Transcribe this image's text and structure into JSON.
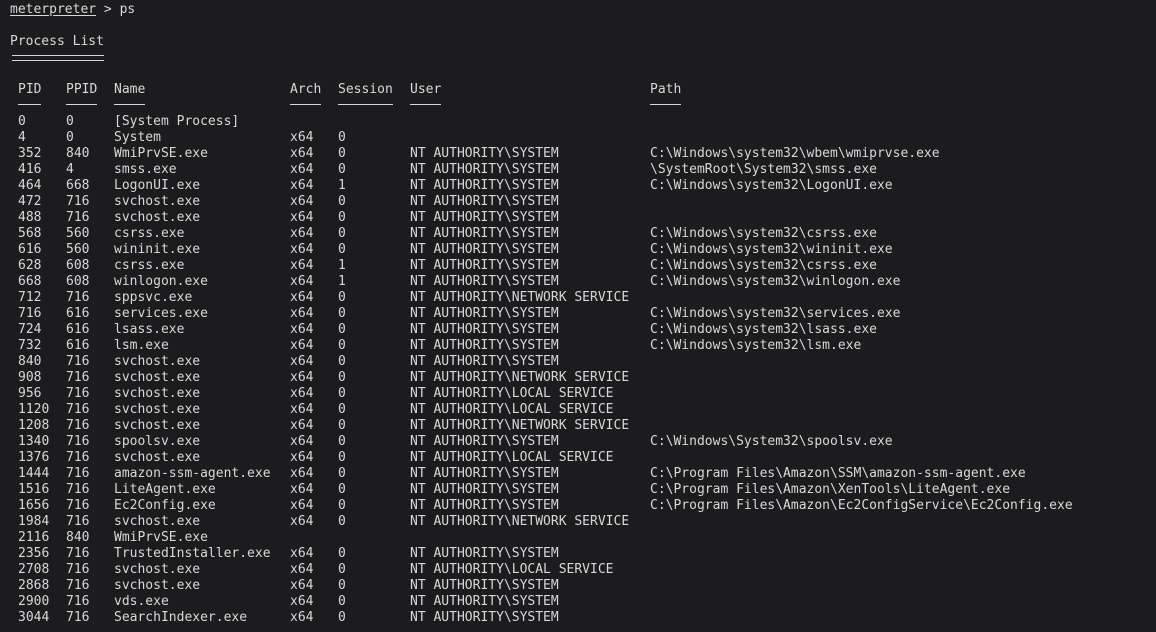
{
  "prompt": {
    "name": "meterpreter",
    "separator": " > ",
    "command": "ps"
  },
  "title": "Process List",
  "headers": {
    "pid": "PID",
    "ppid": "PPID",
    "name": "Name",
    "arch": "Arch",
    "session": "Session",
    "user": "User",
    "path": "Path"
  },
  "rows": [
    {
      "pid": "0",
      "ppid": "0",
      "name": "[System Process]",
      "arch": "",
      "session": "",
      "user": "",
      "path": ""
    },
    {
      "pid": "4",
      "ppid": "0",
      "name": "System",
      "arch": "x64",
      "session": "0",
      "user": "",
      "path": ""
    },
    {
      "pid": "352",
      "ppid": "840",
      "name": "WmiPrvSE.exe",
      "arch": "x64",
      "session": "0",
      "user": "NT AUTHORITY\\SYSTEM",
      "path": "C:\\Windows\\system32\\wbem\\wmiprvse.exe"
    },
    {
      "pid": "416",
      "ppid": "4",
      "name": "smss.exe",
      "arch": "x64",
      "session": "0",
      "user": "NT AUTHORITY\\SYSTEM",
      "path": "\\SystemRoot\\System32\\smss.exe"
    },
    {
      "pid": "464",
      "ppid": "668",
      "name": "LogonUI.exe",
      "arch": "x64",
      "session": "1",
      "user": "NT AUTHORITY\\SYSTEM",
      "path": "C:\\Windows\\system32\\LogonUI.exe"
    },
    {
      "pid": "472",
      "ppid": "716",
      "name": "svchost.exe",
      "arch": "x64",
      "session": "0",
      "user": "NT AUTHORITY\\SYSTEM",
      "path": ""
    },
    {
      "pid": "488",
      "ppid": "716",
      "name": "svchost.exe",
      "arch": "x64",
      "session": "0",
      "user": "NT AUTHORITY\\SYSTEM",
      "path": ""
    },
    {
      "pid": "568",
      "ppid": "560",
      "name": "csrss.exe",
      "arch": "x64",
      "session": "0",
      "user": "NT AUTHORITY\\SYSTEM",
      "path": "C:\\Windows\\system32\\csrss.exe"
    },
    {
      "pid": "616",
      "ppid": "560",
      "name": "wininit.exe",
      "arch": "x64",
      "session": "0",
      "user": "NT AUTHORITY\\SYSTEM",
      "path": "C:\\Windows\\system32\\wininit.exe"
    },
    {
      "pid": "628",
      "ppid": "608",
      "name": "csrss.exe",
      "arch": "x64",
      "session": "1",
      "user": "NT AUTHORITY\\SYSTEM",
      "path": "C:\\Windows\\system32\\csrss.exe"
    },
    {
      "pid": "668",
      "ppid": "608",
      "name": "winlogon.exe",
      "arch": "x64",
      "session": "1",
      "user": "NT AUTHORITY\\SYSTEM",
      "path": "C:\\Windows\\system32\\winlogon.exe"
    },
    {
      "pid": "712",
      "ppid": "716",
      "name": "sppsvc.exe",
      "arch": "x64",
      "session": "0",
      "user": "NT AUTHORITY\\NETWORK SERVICE",
      "path": ""
    },
    {
      "pid": "716",
      "ppid": "616",
      "name": "services.exe",
      "arch": "x64",
      "session": "0",
      "user": "NT AUTHORITY\\SYSTEM",
      "path": "C:\\Windows\\system32\\services.exe"
    },
    {
      "pid": "724",
      "ppid": "616",
      "name": "lsass.exe",
      "arch": "x64",
      "session": "0",
      "user": "NT AUTHORITY\\SYSTEM",
      "path": "C:\\Windows\\system32\\lsass.exe"
    },
    {
      "pid": "732",
      "ppid": "616",
      "name": "lsm.exe",
      "arch": "x64",
      "session": "0",
      "user": "NT AUTHORITY\\SYSTEM",
      "path": "C:\\Windows\\system32\\lsm.exe"
    },
    {
      "pid": "840",
      "ppid": "716",
      "name": "svchost.exe",
      "arch": "x64",
      "session": "0",
      "user": "NT AUTHORITY\\SYSTEM",
      "path": ""
    },
    {
      "pid": "908",
      "ppid": "716",
      "name": "svchost.exe",
      "arch": "x64",
      "session": "0",
      "user": "NT AUTHORITY\\NETWORK SERVICE",
      "path": ""
    },
    {
      "pid": "956",
      "ppid": "716",
      "name": "svchost.exe",
      "arch": "x64",
      "session": "0",
      "user": "NT AUTHORITY\\LOCAL SERVICE",
      "path": ""
    },
    {
      "pid": "1120",
      "ppid": "716",
      "name": "svchost.exe",
      "arch": "x64",
      "session": "0",
      "user": "NT AUTHORITY\\LOCAL SERVICE",
      "path": ""
    },
    {
      "pid": "1208",
      "ppid": "716",
      "name": "svchost.exe",
      "arch": "x64",
      "session": "0",
      "user": "NT AUTHORITY\\NETWORK SERVICE",
      "path": ""
    },
    {
      "pid": "1340",
      "ppid": "716",
      "name": "spoolsv.exe",
      "arch": "x64",
      "session": "0",
      "user": "NT AUTHORITY\\SYSTEM",
      "path": "C:\\Windows\\System32\\spoolsv.exe"
    },
    {
      "pid": "1376",
      "ppid": "716",
      "name": "svchost.exe",
      "arch": "x64",
      "session": "0",
      "user": "NT AUTHORITY\\LOCAL SERVICE",
      "path": ""
    },
    {
      "pid": "1444",
      "ppid": "716",
      "name": "amazon-ssm-agent.exe",
      "arch": "x64",
      "session": "0",
      "user": "NT AUTHORITY\\SYSTEM",
      "path": "C:\\Program Files\\Amazon\\SSM\\amazon-ssm-agent.exe"
    },
    {
      "pid": "1516",
      "ppid": "716",
      "name": "LiteAgent.exe",
      "arch": "x64",
      "session": "0",
      "user": "NT AUTHORITY\\SYSTEM",
      "path": "C:\\Program Files\\Amazon\\XenTools\\LiteAgent.exe"
    },
    {
      "pid": "1656",
      "ppid": "716",
      "name": "Ec2Config.exe",
      "arch": "x64",
      "session": "0",
      "user": "NT AUTHORITY\\SYSTEM",
      "path": "C:\\Program Files\\Amazon\\Ec2ConfigService\\Ec2Config.exe"
    },
    {
      "pid": "1984",
      "ppid": "716",
      "name": "svchost.exe",
      "arch": "x64",
      "session": "0",
      "user": "NT AUTHORITY\\NETWORK SERVICE",
      "path": ""
    },
    {
      "pid": "2116",
      "ppid": "840",
      "name": "WmiPrvSE.exe",
      "arch": "",
      "session": "",
      "user": "",
      "path": ""
    },
    {
      "pid": "2356",
      "ppid": "716",
      "name": "TrustedInstaller.exe",
      "arch": "x64",
      "session": "0",
      "user": "NT AUTHORITY\\SYSTEM",
      "path": ""
    },
    {
      "pid": "2708",
      "ppid": "716",
      "name": "svchost.exe",
      "arch": "x64",
      "session": "0",
      "user": "NT AUTHORITY\\LOCAL SERVICE",
      "path": ""
    },
    {
      "pid": "2868",
      "ppid": "716",
      "name": "svchost.exe",
      "arch": "x64",
      "session": "0",
      "user": "NT AUTHORITY\\SYSTEM",
      "path": ""
    },
    {
      "pid": "2900",
      "ppid": "716",
      "name": "vds.exe",
      "arch": "x64",
      "session": "0",
      "user": "NT AUTHORITY\\SYSTEM",
      "path": ""
    },
    {
      "pid": "3044",
      "ppid": "716",
      "name": "SearchIndexer.exe",
      "arch": "x64",
      "session": "0",
      "user": "NT AUTHORITY\\SYSTEM",
      "path": ""
    }
  ]
}
